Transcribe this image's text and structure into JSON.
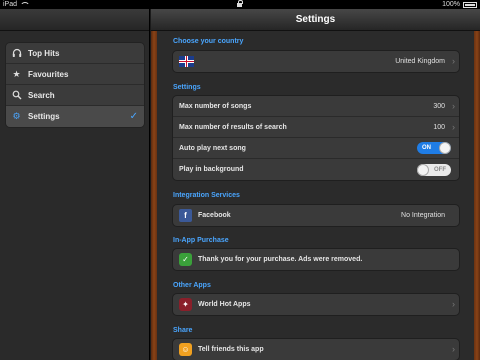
{
  "status": {
    "device": "iPad",
    "battery": "100%"
  },
  "main": {
    "title": "Settings"
  },
  "sidebar": {
    "items": [
      {
        "label": "Top Hits",
        "icon": "headphones-icon"
      },
      {
        "label": "Favourites",
        "icon": "star-icon"
      },
      {
        "label": "Search",
        "icon": "search-icon"
      },
      {
        "label": "Settings",
        "icon": "gear-icon",
        "selected": true
      }
    ]
  },
  "sections": {
    "country": {
      "title": "Choose your country",
      "value": "United Kingdom"
    },
    "settings": {
      "title": "Settings",
      "max_songs": {
        "label": "Max number of songs",
        "value": "300"
      },
      "max_results": {
        "label": "Max number of results of search",
        "value": "100"
      },
      "auto_play": {
        "label": "Auto play next song",
        "state": "ON"
      },
      "background": {
        "label": "Play in background",
        "state": "OFF"
      }
    },
    "integration": {
      "title": "Integration Services",
      "label": "Facebook",
      "value": "No Integration"
    },
    "purchase": {
      "title": "In-App Purchase",
      "label": "Thank you for your purchase. Ads were removed."
    },
    "other_apps": {
      "title": "Other Apps",
      "label": "World Hot Apps"
    },
    "share": {
      "title": "Share",
      "label": "Tell friends this app"
    }
  },
  "colors": {
    "accent": "#4aa6ff",
    "toggle_on": "#1f7de6",
    "wood": "#8a4316"
  }
}
